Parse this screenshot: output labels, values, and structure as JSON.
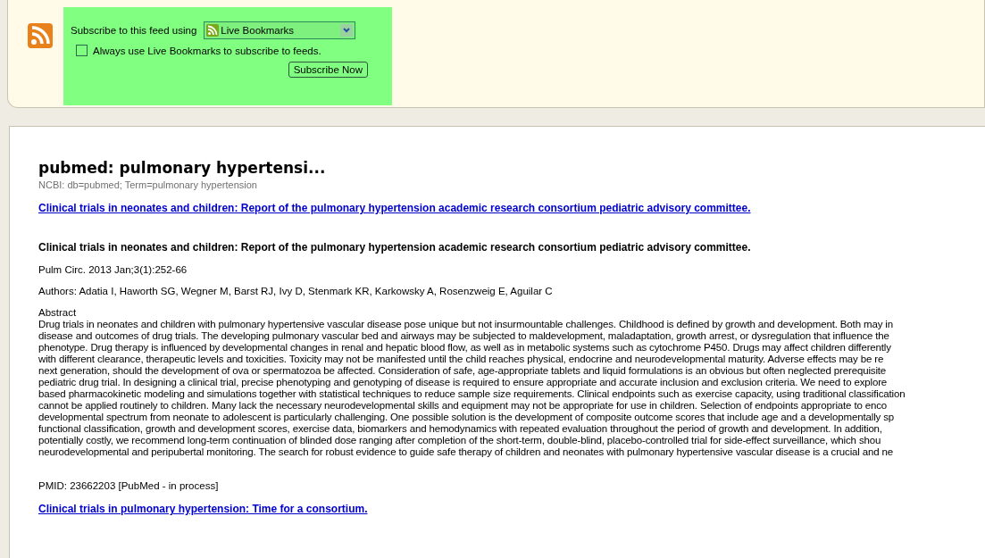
{
  "subscribe": {
    "label": "Subscribe to this feed using",
    "reader": "Live Bookmarks",
    "always_use": {
      "label": "Always use Live Bookmarks to subscribe to feeds.",
      "checked": false
    },
    "button": "Subscribe Now"
  },
  "feed": {
    "title": "pubmed: pulmonary hypertensi...",
    "subtitle": "NCBI: db=pubmed; Term=pulmonary hypertension",
    "entries": [
      {
        "link": "Clinical trials in neonates and children: Report of the pulmonary hypertension academic research consortium pediatric advisory committee.",
        "heading": "Clinical trials in neonates and children: Report of the pulmonary hypertension academic research consortium pediatric advisory committee.",
        "citation": "Pulm Circ. 2013 Jan;3(1):252-66",
        "authors": "Authors: Adatia I, Haworth SG, Wegner M, Barst RJ, Ivy D, Stenmark KR, Karkowsky A, Rosenzweig E, Aguilar C",
        "abstract_label": "Abstract",
        "abstract_lines": [
          "Drug trials in neonates and children with pulmonary hypertensive vascular disease pose unique but not insurmountable challenges. Childhood is defined by growth and development. Both may in",
          "disease and outcomes of drug trials. The developing pulmonary vascular bed and airways may be subjected to maldevelopment, maladaptation, growth arrest, or dysregulation that influence the",
          "phenotype. Drug therapy is influenced by developmental changes in renal and hepatic blood flow, as well as in metabolic systems such as cytochrome P450. Drugs may affect children differently",
          "with different clearance, therapeutic levels and toxicities. Toxicity may not be manifested until the child reaches physical, endocrine and neurodevelopmental maturity. Adverse effects may be re",
          "next generation, should the development of ova or spermatozoa be affected. Consideration of safe, age-appropriate tablets and liquid formulations is an obvious but often neglected prerequisite",
          "pediatric drug trial. In designing a clinical trial, precise phenotyping and genotyping of disease is required to ensure appropriate and accurate inclusion and exclusion criteria. We need to explore",
          "based pharmacokinetic modeling and simulations together with statistical techniques to reduce sample size requirements. Clinical endpoints such as exercise capacity, using traditional classification",
          "cannot be applied routinely to children. Many lack the necessary neurodevelopmental skills and equipment may not be appropriate for use in children. Selection of endpoints appropriate to enco",
          "developmental spectrum from neonate to adolescent is particularly challenging. One possible solution is the development of composite outcome scores that include age and a developmentally sp",
          "functional classification, growth and development scores, exercise data, biomarkers and hemodynamics with repeated evaluation throughout the period of growth and development. In addition,",
          "potentially costly, we recommend long-term continuation of blinded dose ranging after completion of the short-term, double-blind, placebo-controlled trial for side-effect surveillance, which shou",
          "neurodevelopmental and peripubertal monitoring. The search for robust evidence to guide safe therapy of children and neonates with pulmonary hypertensive vascular disease is a crucial and ne"
        ],
        "pmid": "PMID: 23662203 [PubMed - in process]"
      },
      {
        "link": "Clinical trials in pulmonary hypertension: Time for a consortium."
      }
    ]
  }
}
